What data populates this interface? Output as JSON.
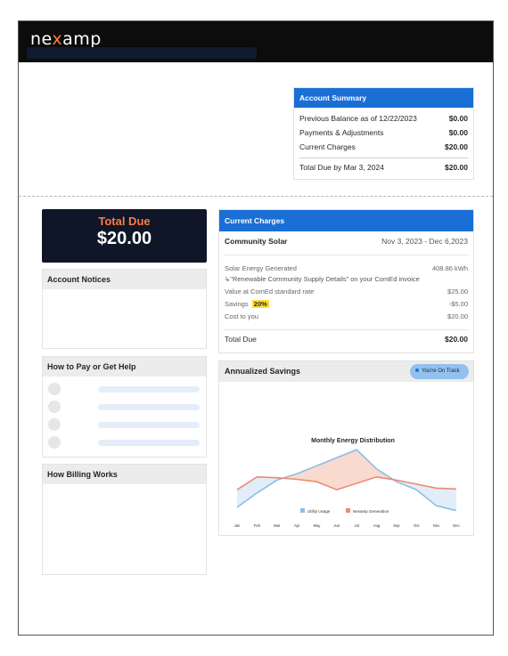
{
  "brand": {
    "logo_pre": "ne",
    "logo_x": "x",
    "logo_post": "amp"
  },
  "account_summary": {
    "title": "Account Summary",
    "rows": [
      {
        "label": "Previous Balance as of 12/22/2023",
        "amount": "$0.00"
      },
      {
        "label": "Payments & Adjustments",
        "amount": "$0.00"
      },
      {
        "label": "Current Charges",
        "amount": "$20.00"
      }
    ],
    "total_label": "Total Due by Mar 3, 2024",
    "total_amount": "$20.00"
  },
  "total_due": {
    "label": "Total Due",
    "amount": "$20.00"
  },
  "panels": {
    "notices": "Account Notices",
    "help": "How to Pay or Get Help",
    "billing": "How Billing Works"
  },
  "current_charges": {
    "title": "Current Charges",
    "item_name": "Community Solar",
    "period": "Nov 3, 2023 - Dec 6,2023",
    "generated_label": "Solar Energy Generated",
    "generated_value": "408.86 kWh",
    "note": "↳\"Renewable Community Supply Details\" on your ComEd invoice",
    "value_label": "Value at ComEd standard rate",
    "value_amount": "$25.00",
    "savings_label": "Savings",
    "savings_pct": "20%",
    "savings_amount": "-$5.00",
    "cost_label": "Cost to you",
    "cost_amount": "$20.00",
    "total_label": "Total Due",
    "total_amount": "$20.00"
  },
  "annualized_savings": {
    "title": "Annualized Savings",
    "status": "You're On Track"
  },
  "colors": {
    "accent": "#1a6fd6",
    "orange": "#ff7a45",
    "dark": "#0f1628",
    "utility": "#8bbde8",
    "nexamp": "#ee8a70"
  },
  "chart_data": {
    "type": "line",
    "title": "Monthly Energy Distribution",
    "categories": [
      "Jan",
      "Feb",
      "Mar",
      "Apr",
      "May",
      "Jun",
      "Jul",
      "Aug",
      "Sep",
      "Oct",
      "Nov",
      "Dec"
    ],
    "series": [
      {
        "name": "Utility Usage",
        "color": "#8bbde8",
        "values": [
          10,
          28,
          44,
          52,
          62,
          72,
          82,
          58,
          42,
          32,
          12,
          6
        ]
      },
      {
        "name": "Nexamp Generation",
        "color": "#ee8a70",
        "values": [
          32,
          48,
          47,
          45,
          42,
          32,
          40,
          48,
          44,
          39,
          34,
          33
        ]
      }
    ],
    "ylim": [
      0,
      100
    ],
    "legend": "bottom"
  }
}
